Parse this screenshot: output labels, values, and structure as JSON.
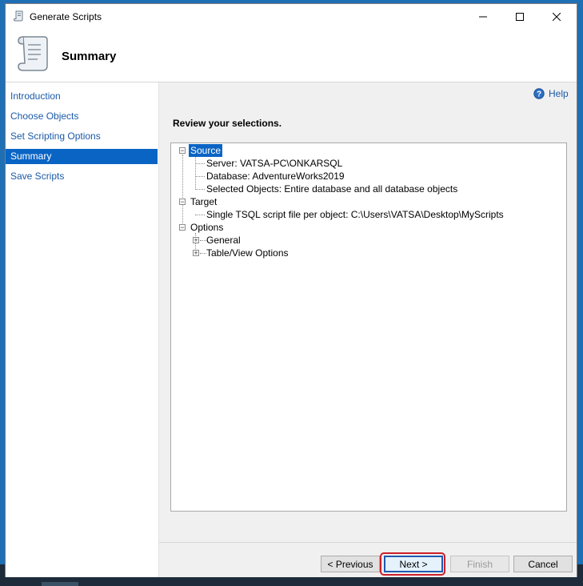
{
  "window": {
    "title": "Generate Scripts"
  },
  "header": {
    "title": "Summary"
  },
  "sidebar": {
    "items": [
      {
        "label": "Introduction",
        "active": false
      },
      {
        "label": "Choose Objects",
        "active": false
      },
      {
        "label": "Set Scripting Options",
        "active": false
      },
      {
        "label": "Summary",
        "active": true
      },
      {
        "label": "Save Scripts",
        "active": false
      }
    ]
  },
  "help": {
    "label": "Help"
  },
  "main": {
    "review_label": "Review your selections."
  },
  "tree": {
    "source": {
      "label": "Source",
      "children": [
        "Server: VATSA-PC\\ONKARSQL",
        "Database: AdventureWorks2019",
        "Selected Objects: Entire database and all database objects"
      ]
    },
    "target": {
      "label": "Target",
      "children": [
        "Single TSQL script file per object: C:\\Users\\VATSA\\Desktop\\MyScripts"
      ]
    },
    "options": {
      "label": "Options",
      "children": [
        "General",
        "Table/View Options"
      ]
    }
  },
  "buttons": {
    "previous": "< Previous",
    "next": "Next >",
    "finish": "Finish",
    "cancel": "Cancel"
  },
  "colors": {
    "accent": "#0a64c4",
    "link": "#1b5aa8",
    "highlight": "#cc1f2a"
  }
}
